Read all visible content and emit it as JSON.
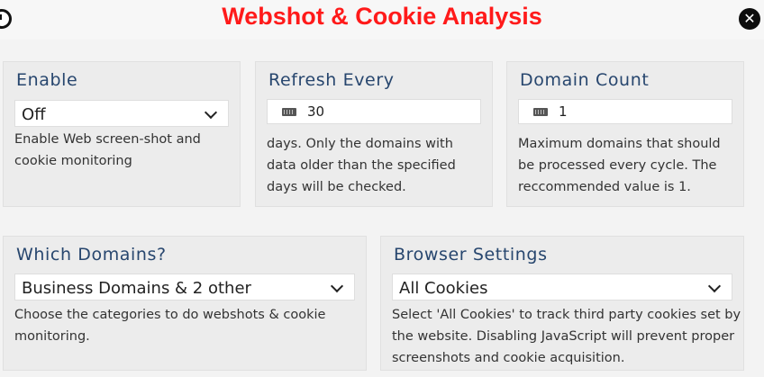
{
  "window": {
    "title": "Webshot & Cookie Analysis",
    "close_label": "✕"
  },
  "enable": {
    "title": "Enable",
    "selected": "Off",
    "line1": "Enable Web screen-shot and",
    "line2": "cookie monitoring"
  },
  "refresh": {
    "title": "Refresh Every",
    "value": "30",
    "line1": "days. Only the domains with",
    "line2": "data older than the specified",
    "line3": "days will be checked."
  },
  "domain_count": {
    "title": "Domain Count",
    "value": "1",
    "line1": "Maximum domains that should",
    "line2": "be processed every cycle. The",
    "line3": "reccommended value is 1."
  },
  "which_domains": {
    "title": "Which Domains?",
    "selected": "Business Domains & 2 other",
    "line1": "Choose the categories to do webshots & cookie",
    "line2": "monitoring."
  },
  "browser": {
    "title": "Browser Settings",
    "selected": "All Cookies",
    "line1": "Select 'All Cookies' to track third party cookies set by",
    "line2": "the website. Disabling JavaScript will prevent proper",
    "line3": "screenshots and cookie acquisition."
  }
}
